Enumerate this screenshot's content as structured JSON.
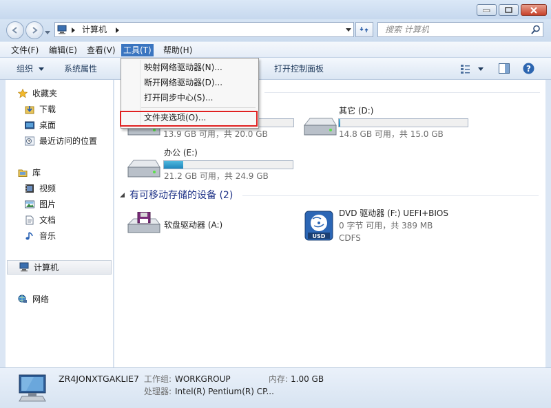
{
  "address": {
    "path_item": "计算机",
    "search_placeholder": "搜索 计算机"
  },
  "menubar": {
    "items": [
      "文件(F)",
      "编辑(E)",
      "查看(V)",
      "工具(T)",
      "帮助(H)"
    ]
  },
  "toolbar": {
    "organize": "组织",
    "system_properties": "系统属性",
    "open_control_panel": "打开控制面板"
  },
  "tools_menu": {
    "items": [
      "映射网络驱动器(N)...",
      "断开网络驱动器(D)...",
      "打开同步中心(S)...",
      "文件夹选项(O)..."
    ]
  },
  "nav": {
    "favorites": "收藏夹",
    "downloads": "下载",
    "desktop": "桌面",
    "recent": "最近访问的位置",
    "libraries": "库",
    "videos": "视频",
    "pictures": "图片",
    "documents": "文档",
    "music": "音乐",
    "computer": "计算机",
    "network": "网络"
  },
  "drives": [
    {
      "name": "",
      "space": "13.9 GB 可用，共 20.0 GB",
      "used_fraction": 0.31
    },
    {
      "name": "其它 (D:)",
      "space": "14.8 GB 可用，共 15.0 GB",
      "used_fraction": 0.01
    },
    {
      "name": "办公 (E:)",
      "space": "21.2 GB 可用，共 24.9 GB",
      "used_fraction": 0.15
    }
  ],
  "removable_header": "有可移动存储的设备 (2)",
  "removable": [
    {
      "name": "软盘驱动器 (A:)"
    },
    {
      "name": "DVD 驱动器 (F:) UEFI+BIOS",
      "space": "0 字节 可用，共 389 MB",
      "fs": "CDFS",
      "icon_text": "USD"
    }
  ],
  "status": {
    "computer_name": "ZR4JONXTGAKLIE7",
    "workgroup_label": "工作组:",
    "workgroup_value": "WORKGROUP",
    "memory_label": "内存:",
    "memory_value": "1.00 GB",
    "processor_label": "处理器:",
    "processor_value": "Intel(R) Pentium(R) CP..."
  },
  "colors": {
    "accent": "#3a75c0",
    "highlight_box": "#e02020",
    "group_header": "#1e3287"
  }
}
